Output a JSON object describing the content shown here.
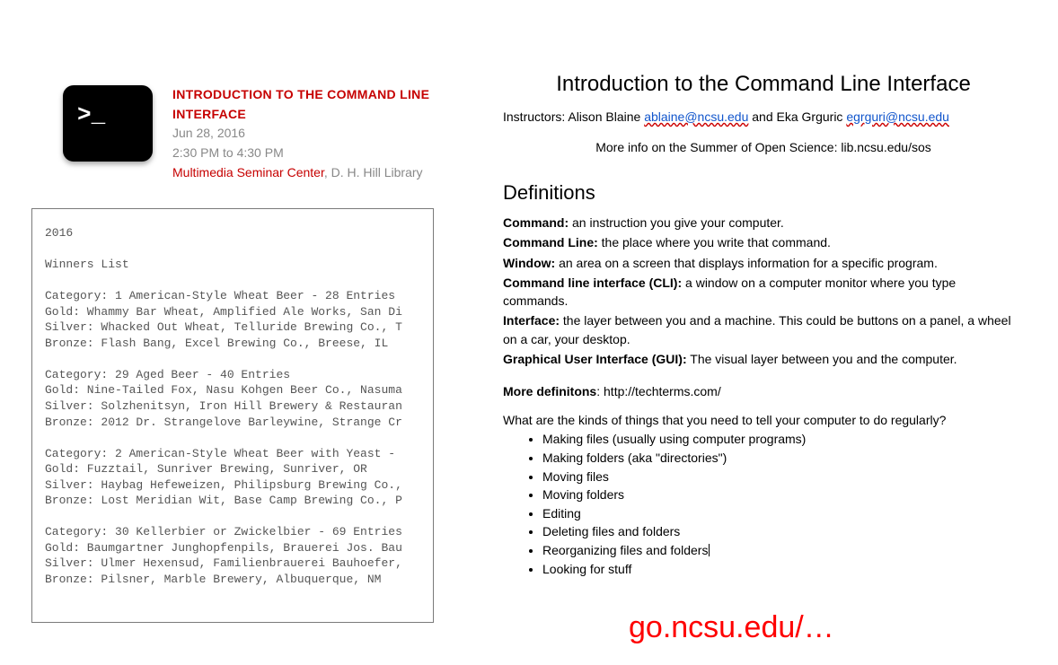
{
  "event": {
    "title": "INTRODUCTION TO THE COMMAND LINE INTERFACE",
    "date": "Jun 28, 2016",
    "time": "2:30 PM to 4:30 PM",
    "location_link": "Multimedia Seminar Center",
    "location_rest": ", D. H. Hill Library",
    "icon_prompt": ">_"
  },
  "winners": {
    "body": "2016\n\nWinners List\n\nCategory: 1 American-Style Wheat Beer - 28 Entries\nGold: Whammy Bar Wheat, Amplified Ale Works, San Di\nSilver: Whacked Out Wheat, Telluride Brewing Co., T\nBronze: Flash Bang, Excel Brewing Co., Breese, IL\n\nCategory: 29 Aged Beer - 40 Entries\nGold: Nine-Tailed Fox, Nasu Kohgen Beer Co., Nasuma\nSilver: Solzhenitsyn, Iron Hill Brewery & Restauran\nBronze: 2012 Dr. Strangelove Barleywine, Strange Cr\n\nCategory: 2 American-Style Wheat Beer with Yeast -\nGold: Fuzztail, Sunriver Brewing, Sunriver, OR\nSilver: Haybag Hefeweizen, Philipsburg Brewing Co.,\nBronze: Lost Meridian Wit, Base Camp Brewing Co., P\n\nCategory: 30 Kellerbier or Zwickelbier - 69 Entries\nGold: Baumgartner Junghopfenpils, Brauerei Jos. Bau\nSilver: Ulmer Hexensud, Familienbrauerei Bauhoefer,\nBronze: Pilsner, Marble Brewery, Albuquerque, NM"
  },
  "doc": {
    "title": "Introduction to the Command Line Interface",
    "instructors_prefix": "Instructors: Alison Blaine ",
    "email1": "ablaine@ncsu.edu",
    "instructors_mid": " and Eka Grguric ",
    "email2": "egrguri@ncsu.edu",
    "more_info": "More info on the Summer of Open Science: lib.ncsu.edu/sos",
    "definitions_heading": "Definitions",
    "defs": [
      {
        "term": "Command:",
        "body": " an instruction you give your computer."
      },
      {
        "term": "Command Line:",
        "body": " the place where you write that command."
      },
      {
        "term": "Window:",
        "body": " an area on a screen that displays information for a specific program."
      },
      {
        "term": "Command line interface (CLI):",
        "body": " a window on a computer monitor where you type commands."
      },
      {
        "term": "Interface:",
        "body": " the layer between you and a machine. This could be buttons on a panel, a wheel on a car, your desktop."
      },
      {
        "term": "Graphical User Interface (GUI):",
        "body": "  The visual layer between you and the computer."
      }
    ],
    "more_defs_label": "More definitons",
    "more_defs_value": ": http://techterms.com/",
    "question": "What are the kinds of things that you need to tell your computer to do regularly?",
    "tasks": [
      "Making files (usually using computer programs)",
      "Making folders (aka \"directories\")",
      "Moving files",
      "Moving folders",
      "Editing",
      "Deleting files and folders",
      "Reorganizing files and folders",
      "Looking for stuff"
    ],
    "cursor_after_index": 6,
    "big_url": "go.ncsu.edu/…"
  }
}
